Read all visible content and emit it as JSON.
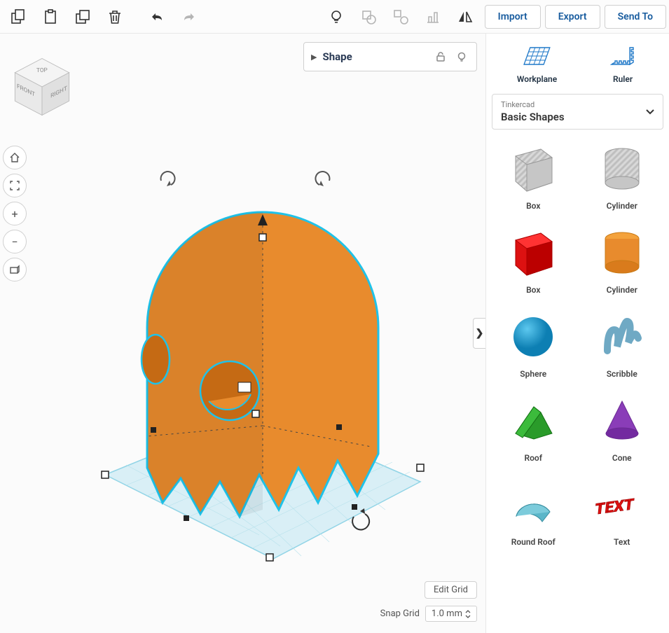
{
  "toolbar": {
    "import_label": "Import",
    "export_label": "Export",
    "sendto_label": "Send To"
  },
  "shape_panel": {
    "title": "Shape"
  },
  "right_tools": {
    "workplane_label": "Workplane",
    "ruler_label": "Ruler"
  },
  "category": {
    "top": "Tinkercad",
    "main": "Basic Shapes"
  },
  "shapes": [
    [
      {
        "label": "Box",
        "kind": "box-striped"
      },
      {
        "label": "Cylinder",
        "kind": "cyl-striped"
      }
    ],
    [
      {
        "label": "Box",
        "kind": "box-red"
      },
      {
        "label": "Cylinder",
        "kind": "cyl-orange"
      }
    ],
    [
      {
        "label": "Sphere",
        "kind": "sphere-blue"
      },
      {
        "label": "Scribble",
        "kind": "scribble"
      }
    ],
    [
      {
        "label": "Roof",
        "kind": "roof-green"
      },
      {
        "label": "Cone",
        "kind": "cone-purple"
      }
    ],
    [
      {
        "label": "Round Roof",
        "kind": "roundroof"
      },
      {
        "label": "Text",
        "kind": "text-red"
      }
    ]
  ],
  "bottom": {
    "edit_grid": "Edit Grid",
    "snap_label": "Snap Grid",
    "snap_value": "1.0 mm"
  },
  "viewcube": {
    "top": "TOP",
    "front": "FRONT",
    "right": "RIGHT"
  }
}
